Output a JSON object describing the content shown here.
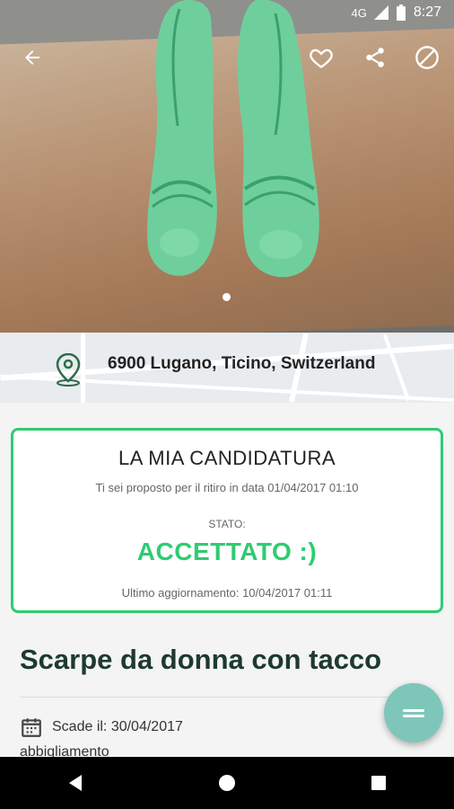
{
  "status_bar": {
    "network": "4G",
    "battery": "8",
    "time": "8:27"
  },
  "top_bar": {
    "back_icon": "arrow-left-icon",
    "favorite_icon": "heart-outline-icon",
    "share_icon": "share-icon",
    "block_icon": "block-icon"
  },
  "photo": {
    "pager_count": 1,
    "pager_active": 1
  },
  "location": {
    "address": "6900 Lugano, Ticino, Switzerland",
    "icon": "map-pin-icon"
  },
  "application": {
    "title": "LA MIA CANDIDATURA",
    "proposal": "Ti sei proposto per il ritiro in data 01/04/2017 01:10",
    "status_label": "STATO:",
    "status_value": "ACCETTATO :)",
    "last_update": "Ultimo aggiornamento: 10/04/2017 01:11",
    "accent": "#2ecc71"
  },
  "item": {
    "title": "Scarpe da donna con tacco",
    "expiry": "Scade il: 30/04/2017",
    "category_partial": "abbigliamento"
  },
  "fab": {
    "icon": "menu-equals-icon",
    "color": "#7fc6ba"
  },
  "nav": {
    "back": "nav-back-icon",
    "home": "nav-home-icon",
    "recents": "nav-recents-icon"
  }
}
